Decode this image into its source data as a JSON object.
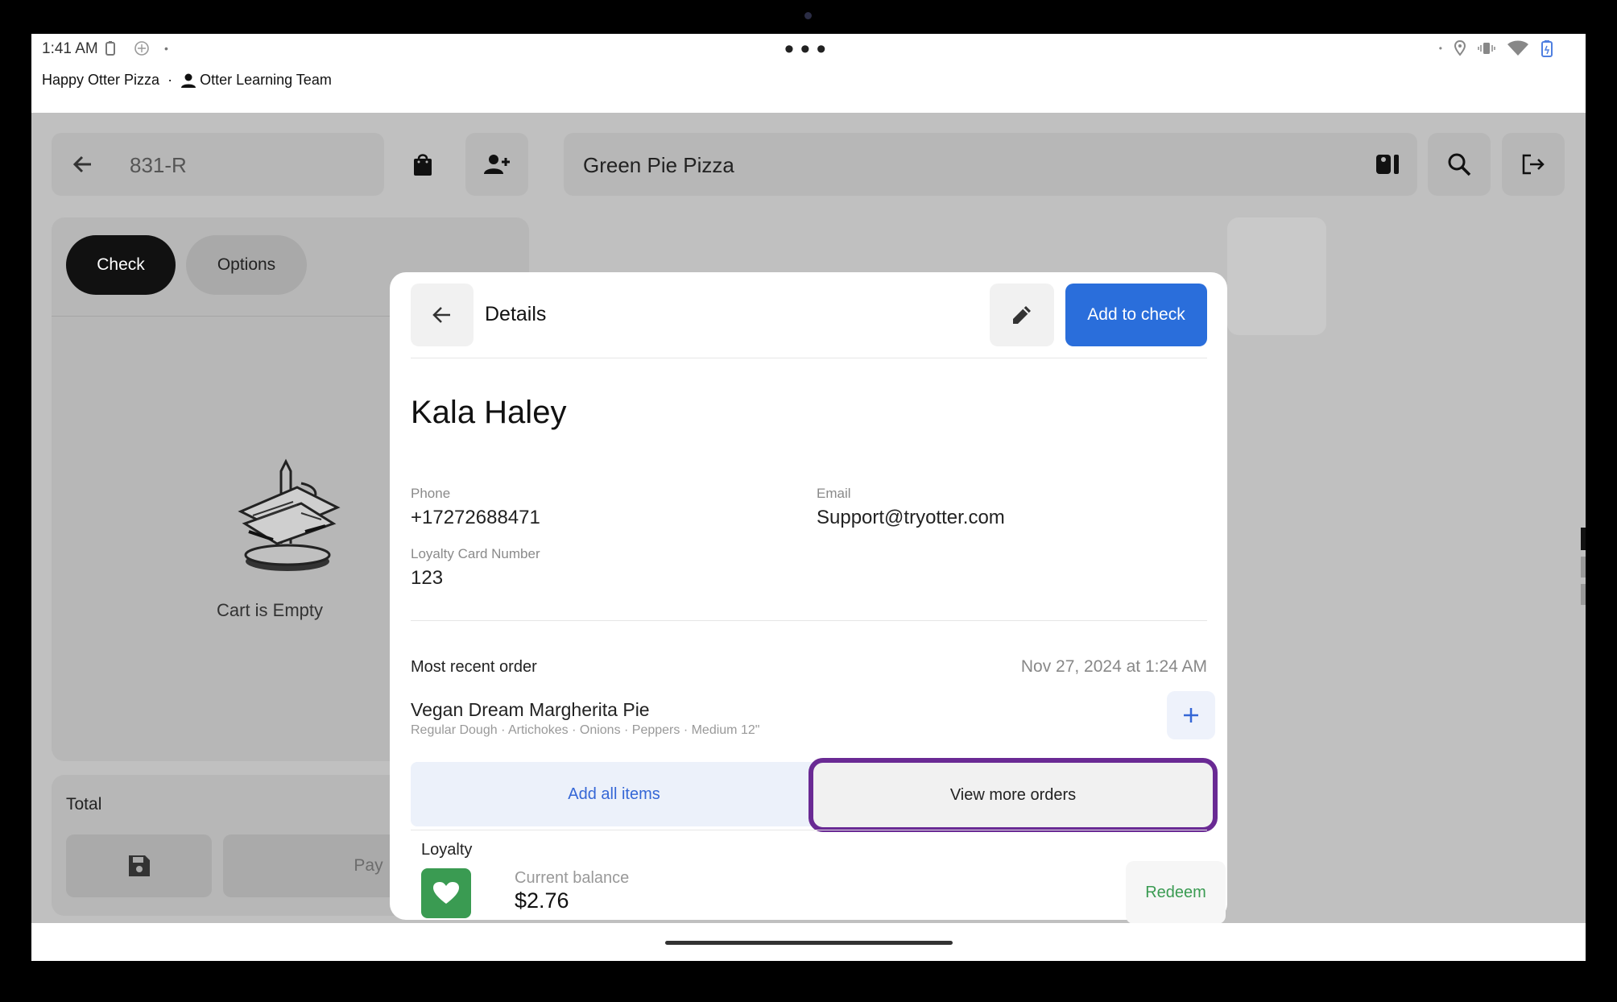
{
  "status_bar": {
    "time": "1:41 AM",
    "business": "Happy Otter Pizza",
    "separator": "·",
    "team": "Otter Learning Team"
  },
  "header": {
    "order_id": "831-R",
    "restaurant": "Green Pie Pizza"
  },
  "left_panel": {
    "tabs": [
      "Check",
      "Options"
    ],
    "empty_message": "Cart is Empty",
    "total_label": "Total",
    "pay_label": "Pay"
  },
  "modal": {
    "title": "Details",
    "add_to_check_label": "Add to check",
    "customer": {
      "name": "Kala Haley",
      "phone_label": "Phone",
      "phone": "+17272688471",
      "email_label": "Email",
      "email": "Support@tryotter.com",
      "loyalty_label": "Loyalty Card Number",
      "loyalty_number": "123"
    },
    "recent_order": {
      "label": "Most recent order",
      "date": "Nov 27, 2024 at 1:24 AM",
      "item_name": "Vegan Dream Margherita Pie",
      "item_modifiers": "Regular Dough · Artichokes · Onions · Peppers · Medium 12\""
    },
    "add_all_label": "Add all items",
    "view_more_label": "View more orders",
    "loyalty": {
      "title": "Loyalty",
      "balance_label": "Current balance",
      "balance": "$2.76",
      "redeem_label": "Redeem"
    }
  },
  "colors": {
    "primary": "#2a6edb",
    "loyalty_green": "#3a9b52",
    "highlight": "#6a2a94",
    "overlay": "#c0c0c0"
  }
}
